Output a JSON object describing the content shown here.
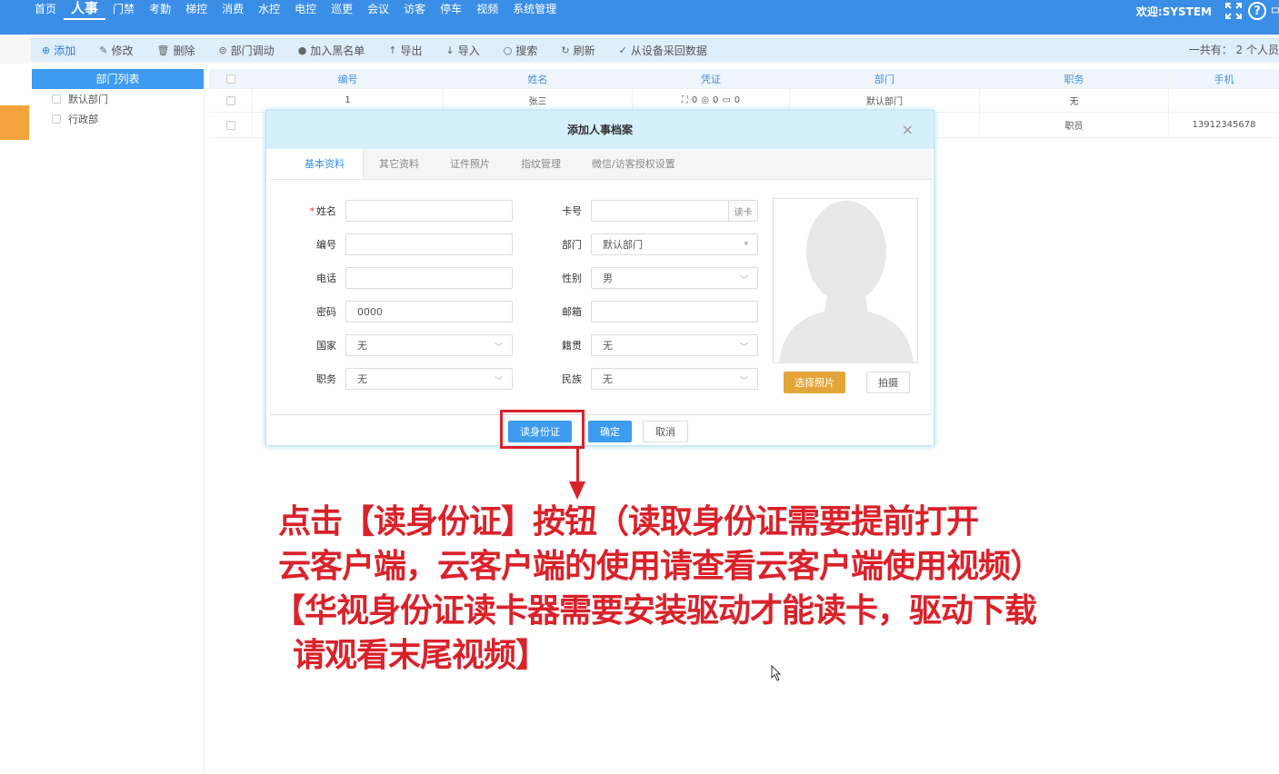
{
  "topnav": {
    "items": [
      "首页",
      "人事",
      "门禁",
      "考勤",
      "梯控",
      "消费",
      "水控",
      "电控",
      "巡更",
      "会议",
      "访客",
      "停车",
      "视频",
      "系统管理"
    ],
    "active_index": 1,
    "welcome": "欢迎:SYSTEM",
    "help": "?"
  },
  "toolbar": {
    "buttons": [
      {
        "label": "添加",
        "icon": "⊕"
      },
      {
        "label": "修改",
        "icon": "✎"
      },
      {
        "label": "删除",
        "icon": "🗑"
      },
      {
        "label": "部门调动",
        "icon": "⊜"
      },
      {
        "label": "加入黑名单",
        "icon": "●"
      },
      {
        "label": "导出",
        "icon": "↑"
      },
      {
        "label": "导入",
        "icon": "↓"
      },
      {
        "label": "搜索",
        "icon": "○"
      },
      {
        "label": "刷新",
        "icon": "↻"
      },
      {
        "label": "从设备采回数据",
        "icon": "✓"
      }
    ],
    "total": "一共有： 2 个人员"
  },
  "dept": {
    "title": "部门列表",
    "items": [
      "默认部门",
      "行政部"
    ]
  },
  "table": {
    "headers": [
      "编号",
      "姓名",
      "凭证",
      "部门",
      "职务",
      "手机"
    ],
    "rows": [
      {
        "id": "1",
        "name": "张三",
        "cred": [
          "0",
          "0",
          "0"
        ],
        "dept": "默认部门",
        "position": "无",
        "phone": ""
      },
      {
        "id": "",
        "name": "",
        "cred": [],
        "dept": "",
        "position": "职员",
        "phone": "13912345678"
      }
    ]
  },
  "modal": {
    "title": "添加人事档案",
    "close": "×",
    "tabs": [
      "基本资料",
      "其它资料",
      "证件照片",
      "指纹管理",
      "微信/访客授权设置"
    ],
    "fields": {
      "name": {
        "label": "姓名",
        "value": ""
      },
      "number": {
        "label": "编号",
        "value": ""
      },
      "phone": {
        "label": "电话",
        "value": ""
      },
      "password": {
        "label": "密码",
        "value": "0000"
      },
      "country": {
        "label": "国家",
        "value": "无"
      },
      "position": {
        "label": "职务",
        "value": "无"
      },
      "card": {
        "label": "卡号",
        "value": "",
        "button": "读卡"
      },
      "dept": {
        "label": "部门",
        "value": "默认部门"
      },
      "gender": {
        "label": "性别",
        "value": "男"
      },
      "email": {
        "label": "邮箱",
        "value": ""
      },
      "hometown": {
        "label": "籍贯",
        "value": "无"
      },
      "ethnicity": {
        "label": "民族",
        "value": "无"
      }
    },
    "photo_buttons": {
      "select": "选择照片",
      "shoot": "拍摄"
    },
    "footer": {
      "read_id": "读身份证",
      "ok": "确定",
      "cancel": "取消"
    }
  },
  "annotation": {
    "lines": [
      "点击【读身份证】按钮（读取身份证需要提前打开",
      "云客户端，云客户端的使用请查看云客户端使用视频）",
      "【华视身份证读卡器需要安装驱动才能读卡，驱动下载",
      "请观看末尾视频】"
    ]
  }
}
